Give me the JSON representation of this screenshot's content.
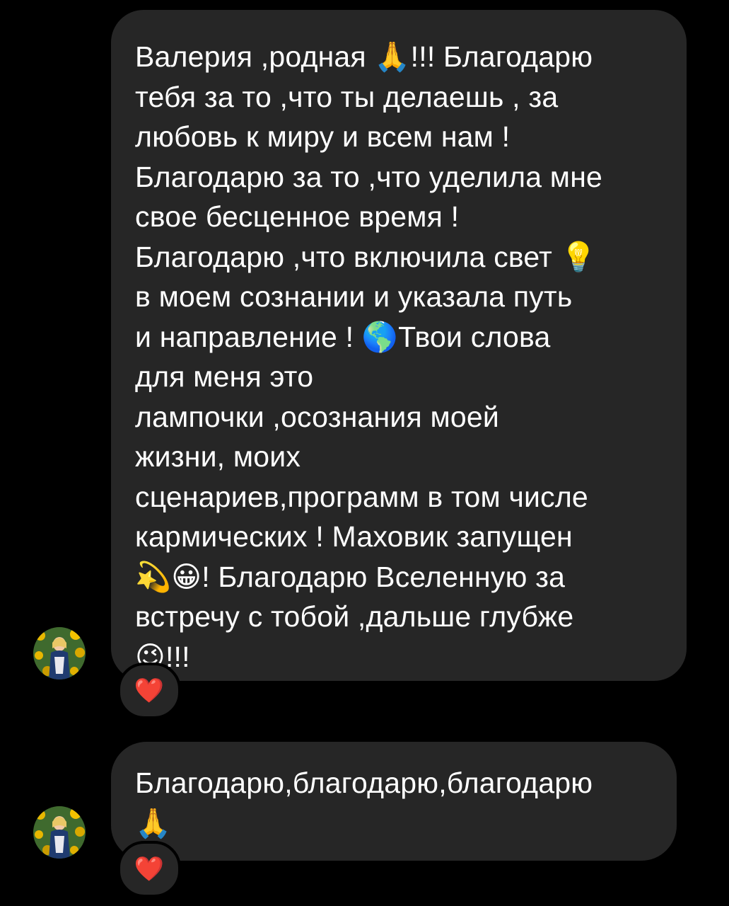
{
  "messages": [
    {
      "text": "Валерия ,родная 🙏!!! Благодарю\nтебя за то ,что ты делаешь , за\nлюбовь к миру и всем нам !\nБлагодарю за то ,что уделила мне\nсвое бесценное время !\nБлагодарю ,что включила свет 💡\nв моем сознании  и  указала путь\nи направление  ! 🌎Твои слова\nдля меня это\nлампочки ,осознания моей\nжизни, моих\nсценариев,программ в том числе\nкармических ! Маховик  запущен\n💫😀! Благодарю Вселенную за\nвстречу с тобой ,дальше глубже\n😉!!!",
      "reaction": "❤️"
    },
    {
      "text": "Благодарю,благодарю,благодарю\n🙏",
      "reaction": "❤️"
    }
  ],
  "colors": {
    "background": "#000000",
    "bubble": "#262626",
    "text": "#ffffff",
    "heart": "#e0245e"
  },
  "icons": {
    "avatar": "user-avatar-sunflowers",
    "reaction": "red-heart-icon"
  }
}
